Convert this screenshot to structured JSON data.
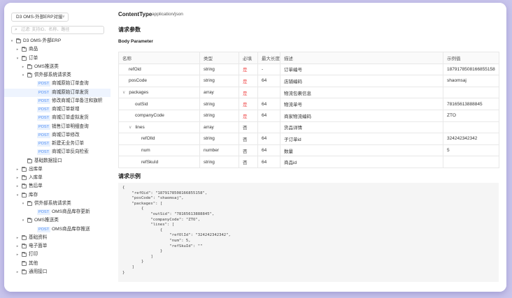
{
  "sidebar": {
    "project_select": "D3 OMS-外部ERP对接",
    "search_placeholder": "过滤: 支持ID、名称、路径",
    "tree": [
      {
        "level": 0,
        "arrow": "open",
        "icon": "folder",
        "label": "D3 OMS-外部ERP"
      },
      {
        "level": 1,
        "arrow": "closed",
        "icon": "folder",
        "label": "商品"
      },
      {
        "level": 1,
        "arrow": "open",
        "icon": "folder",
        "label": "订单"
      },
      {
        "level": 2,
        "arrow": "closed",
        "icon": "folder",
        "label": "OMS推送类"
      },
      {
        "level": 2,
        "arrow": "open",
        "icon": "folder",
        "label": "供外部系统请求类"
      },
      {
        "level": 3,
        "tag": "POST",
        "label": "商城原始订单查询"
      },
      {
        "level": 3,
        "tag": "POST",
        "label": "商城原始订单发货",
        "selected": true
      },
      {
        "level": 3,
        "tag": "POST",
        "label": "修改商城订单备注和旗帜"
      },
      {
        "level": 3,
        "tag": "POST",
        "label": "商城订单新增"
      },
      {
        "level": 3,
        "tag": "POST",
        "label": "商城订单虚拟发货"
      },
      {
        "level": 3,
        "tag": "POST",
        "label": "销售订单明细查询"
      },
      {
        "level": 3,
        "tag": "POST",
        "label": "商城订单修改"
      },
      {
        "level": 3,
        "tag": "POST",
        "label": "新建无业务订单"
      },
      {
        "level": 3,
        "tag": "POST",
        "label": "商城订单反向检索"
      },
      {
        "level": 2,
        "arrow": "none",
        "icon": "folder",
        "label": "基础数据接口"
      },
      {
        "level": 1,
        "arrow": "closed",
        "icon": "folder",
        "label": "出库单"
      },
      {
        "level": 1,
        "arrow": "closed",
        "icon": "folder",
        "label": "入库单"
      },
      {
        "level": 1,
        "arrow": "closed",
        "icon": "folder",
        "label": "售后单"
      },
      {
        "level": 1,
        "arrow": "open",
        "icon": "folder",
        "label": "库存"
      },
      {
        "level": 2,
        "arrow": "open",
        "icon": "folder",
        "label": "供外部系统请求类"
      },
      {
        "level": 3,
        "tag": "POST",
        "label": "OMS商品库存更新"
      },
      {
        "level": 2,
        "arrow": "open",
        "icon": "folder",
        "label": "OMS推送类"
      },
      {
        "level": 3,
        "tag": "POST",
        "label": "OMS商品库存推送"
      },
      {
        "level": 1,
        "arrow": "closed",
        "icon": "folder",
        "label": "基础资料"
      },
      {
        "level": 1,
        "arrow": "closed",
        "icon": "folder",
        "label": "电子面单"
      },
      {
        "level": 1,
        "arrow": "closed",
        "icon": "folder",
        "label": "打印"
      },
      {
        "level": 1,
        "arrow": "none",
        "icon": "folder",
        "label": "其他"
      },
      {
        "level": 1,
        "arrow": "closed",
        "icon": "folder",
        "label": "通用接口"
      }
    ]
  },
  "main": {
    "content_type_label": "ContentType",
    "content_type_value": "application/json",
    "request_params_title": "请求参数",
    "body_param_title": "Body Parameter",
    "table": {
      "headers": [
        "名称",
        "类型",
        "必填",
        "最大长度",
        "描述",
        "示例值"
      ],
      "rows": [
        {
          "indent": 1,
          "expand": "",
          "name": "refOid",
          "type": "string",
          "required": "是",
          "maxlen": "-",
          "desc": "订单编号",
          "example": "1879178508166855158"
        },
        {
          "indent": 1,
          "expand": "",
          "name": "posCode",
          "type": "string",
          "required": "是",
          "maxlen": "64",
          "desc": "店铺编码",
          "example": "shaomsaj"
        },
        {
          "indent": 0,
          "expand": "∨",
          "name": "packages",
          "type": "array",
          "required": "是",
          "maxlen": "",
          "desc": "物流包裹信息",
          "example": ""
        },
        {
          "indent": 2,
          "expand": "",
          "name": "outSid",
          "type": "string",
          "required": "是",
          "maxlen": "64",
          "desc": "物流单号",
          "example": "78165613888845"
        },
        {
          "indent": 2,
          "expand": "",
          "name": "companyCode",
          "type": "string",
          "required": "是",
          "maxlen": "64",
          "desc": "商家物流编码",
          "example": "ZTO"
        },
        {
          "indent": 1,
          "expand": "∨",
          "name": "lines",
          "type": "array",
          "required": "否",
          "maxlen": "",
          "desc": "货品详情",
          "example": ""
        },
        {
          "indent": 3,
          "expand": "",
          "name": "refOlId",
          "type": "string",
          "required": "否",
          "maxlen": "64",
          "desc": "子订单id",
          "example": "324242342342"
        },
        {
          "indent": 3,
          "expand": "",
          "name": "num",
          "type": "number",
          "required": "否",
          "maxlen": "64",
          "desc": "数量",
          "example": "5"
        },
        {
          "indent": 3,
          "expand": "",
          "name": "refSkuId",
          "type": "string",
          "required": "否",
          "maxlen": "64",
          "desc": "商品id",
          "example": ""
        }
      ]
    },
    "request_example_title": "请求示例",
    "code_lines": [
      "{",
      "    \"refOid\": \"1879178508166855158\",",
      "    \"posCode\": \"shaomsaj\",",
      "    \"packages\": [",
      "        {",
      "            \"outSid\": \"78165613888845\",",
      "            \"companyCode\": \"ZTO\",",
      "            \"lines\": [",
      "                {",
      "                    \"refOlId\": \"324242342342\",",
      "                    \"num\": 5,",
      "                    \"refSkuId\": \"\"",
      "                }",
      "            ]",
      "        }",
      "    ]",
      "}"
    ]
  },
  "colors": {
    "background": "#c9c5ec",
    "required_yes": "#f04b4b",
    "post_tag": "#4a8af4",
    "selected_row": "#eef4fe"
  }
}
